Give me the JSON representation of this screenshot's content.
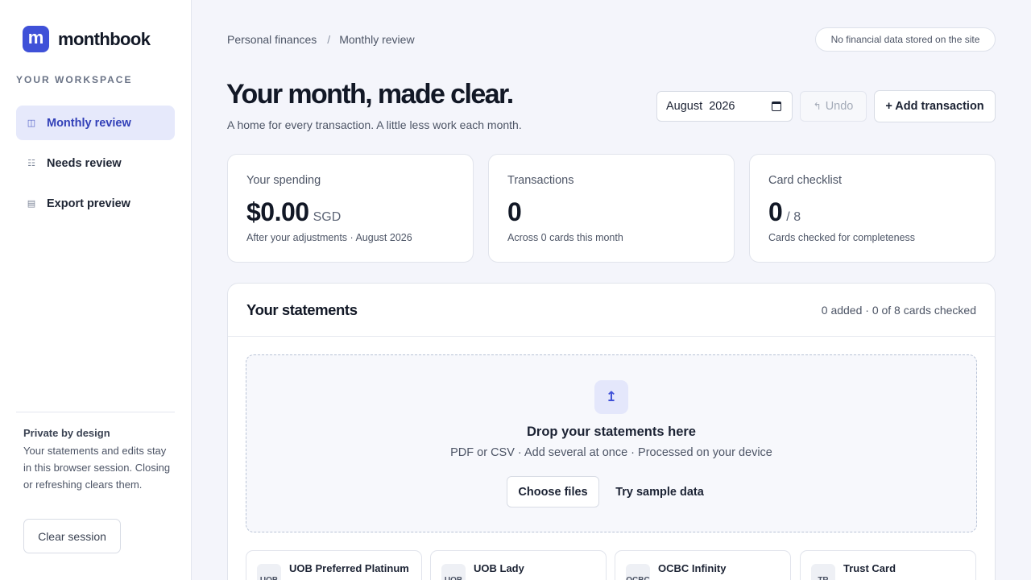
{
  "brand": {
    "logo_letter": "m",
    "name": "monthbook"
  },
  "sidebar": {
    "section_title": "YOUR WORKSPACE",
    "items": [
      {
        "label": "Monthly review",
        "icon": "columns-icon",
        "glyph": "◫",
        "active": true
      },
      {
        "label": "Needs review",
        "icon": "list-icon",
        "glyph": "☷",
        "active": false
      },
      {
        "label": "Export preview",
        "icon": "table-icon",
        "glyph": "▤",
        "active": false
      }
    ],
    "privacy_title": "Private by design",
    "privacy_body": "Your statements and edits stay in this browser session. Closing or refreshing clears them.",
    "clear_label": "Clear session"
  },
  "header": {
    "breadcrumb": [
      "Personal finances",
      "Monthly review"
    ],
    "breadcrumb_sep": "/",
    "privacy_pill": "No financial data stored on the site",
    "title": "Your month, made clear.",
    "subtitle": "A home for every transaction. A little less work each month.",
    "month_value": "August  2026",
    "undo_label": "Undo",
    "undo_glyph": "↰",
    "add_label": "+ Add transaction"
  },
  "stats": [
    {
      "label": "Your spending",
      "value": "$0.00",
      "suffix": "SGD",
      "note": "After your adjustments · August 2026"
    },
    {
      "label": "Transactions",
      "value": "0",
      "suffix": "",
      "note": "Across 0 cards this month"
    },
    {
      "label": "Card checklist",
      "value": "0",
      "suffix": "/ 8",
      "note": "Cards checked for completeness"
    }
  ],
  "statements": {
    "title": "Your statements",
    "meta": "0 added · 0 of 8 cards checked",
    "upload_glyph": "↥",
    "drop_title": "Drop your statements here",
    "drop_sub": "PDF or CSV · Add several at once · Processed on your device",
    "choose_label": "Choose files",
    "sample_label": "Try sample data",
    "cards": [
      {
        "badge": "UOB",
        "name": "UOB Preferred Platinum"
      },
      {
        "badge": "UOB",
        "name": "UOB Lady"
      },
      {
        "badge": "OCBC",
        "name": "OCBC Infinity"
      },
      {
        "badge": "TR",
        "name": "Trust Card"
      }
    ]
  },
  "colors": {
    "accent": "#3f51d8",
    "active_bg": "#e6e9fb",
    "page_bg": "#f4f5fb"
  }
}
